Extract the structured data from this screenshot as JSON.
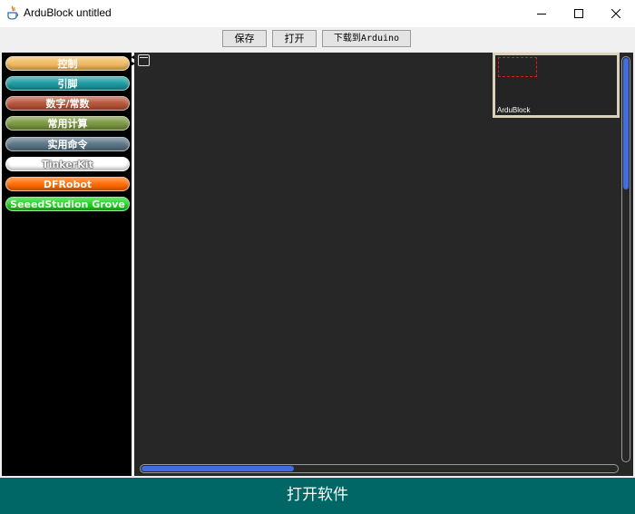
{
  "window": {
    "title": "ArduBlock untitled",
    "icon": "java-cup-icon"
  },
  "toolbar": {
    "save_label": "保存",
    "open_label": "打开",
    "upload_label": "下载到Arduino"
  },
  "palette": {
    "categories": [
      {
        "label": "控制",
        "color": "#f2b95e"
      },
      {
        "label": "引脚",
        "color": "#1a9aa0"
      },
      {
        "label": "数字/常数",
        "color": "#b8533a"
      },
      {
        "label": "常用计算",
        "color": "#7a9640"
      },
      {
        "label": "实用命令",
        "color": "#5a7484"
      },
      {
        "label": "TinkerKit",
        "color": "#ffffff"
      },
      {
        "label": "DFRobot",
        "color": "#ff6a00"
      },
      {
        "label": "SeeedStudion Grove",
        "color": "#1ad41a"
      }
    ]
  },
  "canvas": {
    "minimap_label": "ArduBlock",
    "background": "#272727"
  },
  "caption": {
    "text": "打开软件"
  }
}
